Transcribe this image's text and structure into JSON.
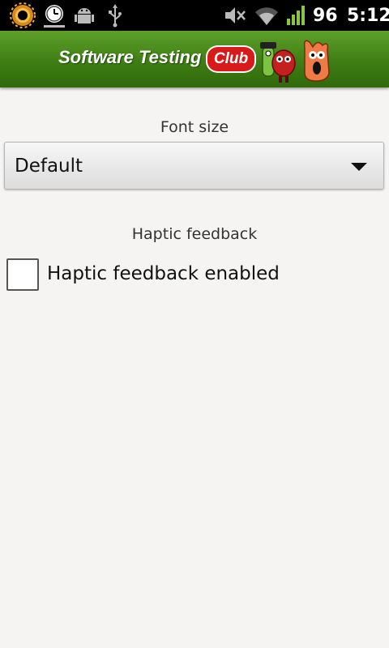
{
  "status_bar": {
    "icons": [
      "sun-notification-icon",
      "clock-notification-icon",
      "android-debug-icon",
      "usb-icon",
      "mute-icon",
      "wifi-icon",
      "signal-icon"
    ],
    "battery": "96",
    "time": "5:12"
  },
  "header": {
    "logo_text": "Software Testing",
    "logo_club": "Club"
  },
  "font_size": {
    "label": "Font size",
    "value": "Default"
  },
  "haptic": {
    "label": "Haptic feedback",
    "checkbox_label": "Haptic feedback enabled",
    "checked": false
  }
}
